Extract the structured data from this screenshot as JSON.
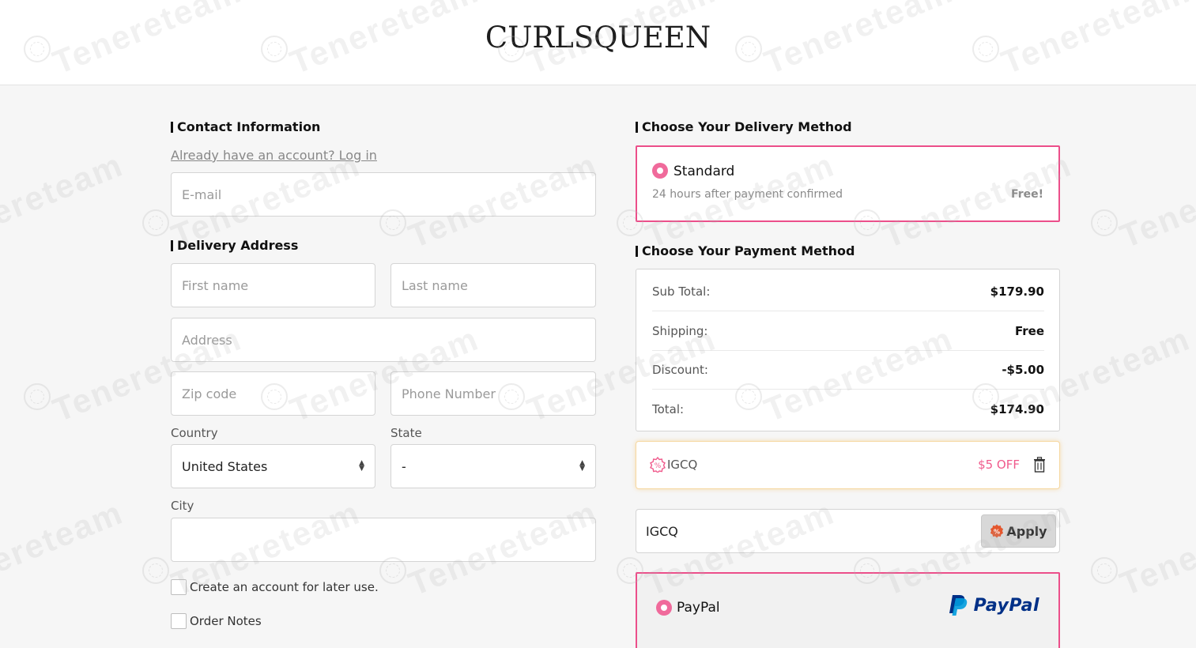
{
  "brand": {
    "logo_text": "CURLSQUEEN"
  },
  "contact": {
    "title": "Contact Information",
    "login_link": "Already have an account? Log in",
    "email_placeholder": "E-mail"
  },
  "delivery_address": {
    "title": "Delivery Address",
    "first_name_placeholder": "First name",
    "last_name_placeholder": "Last name",
    "address_placeholder": "Address",
    "zip_placeholder": "Zip code",
    "phone_placeholder": "Phone Number",
    "country_label": "Country",
    "country_value": "United States",
    "state_label": "State",
    "state_value": "-",
    "city_label": "City",
    "city_value": ""
  },
  "checkboxes": {
    "create_account": "Create an account for later use.",
    "order_notes": "Order Notes"
  },
  "delivery_method": {
    "title": "Choose Your Delivery Method",
    "option_name": "Standard",
    "option_desc": "24 hours after payment confirmed",
    "option_price": "Free!"
  },
  "payment": {
    "title": "Choose Your Payment Method",
    "summary": [
      {
        "label": "Sub Total:",
        "value": "$179.90"
      },
      {
        "label": "Shipping:",
        "value": "Free"
      },
      {
        "label": "Discount:",
        "value": "-$5.00"
      },
      {
        "label": "Total:",
        "value": "$174.90"
      }
    ],
    "applied_coupon_code": "IGCQ",
    "applied_coupon_discount": "$5 OFF",
    "promo_input_value": "IGCQ",
    "apply_label": "Apply",
    "paypal_label": "PayPal",
    "paypal_logo_text": "PayPal"
  },
  "watermark": {
    "text": "Tenereteam"
  },
  "colors": {
    "accent_pink": "#ec4f8a",
    "coupon_pink": "#f05a8c",
    "paypal_dark_blue": "#003087",
    "paypal_light_blue": "#009cde",
    "apply_icon": "#e4572e"
  }
}
